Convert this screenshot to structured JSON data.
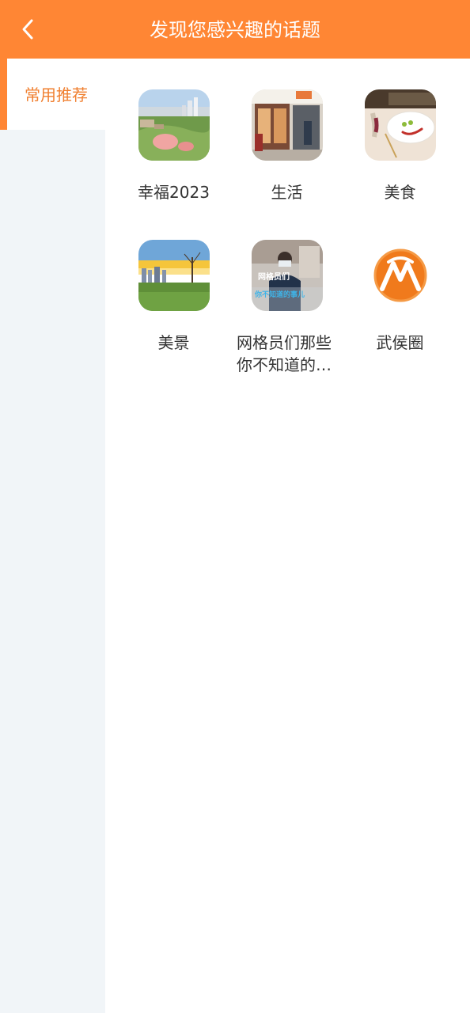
{
  "header": {
    "title": "发现您感兴趣的话题",
    "back_icon": "chevron-left-icon",
    "background": "#ff8634"
  },
  "sidebar": {
    "items": [
      {
        "label": "常用推荐",
        "active": true
      }
    ]
  },
  "topics": [
    {
      "label": "幸福2023",
      "image": "park-aerial-thumbnail"
    },
    {
      "label": "生活",
      "image": "street-storefront-thumbnail"
    },
    {
      "label": "美食",
      "image": "plate-smiley-thumbnail"
    },
    {
      "label": "美景",
      "image": "sunset-skyline-thumbnail"
    },
    {
      "label": "网格员们那些你不知道的事儿",
      "image": "grid-worker-thumbnail",
      "overlay_text": "网格员们 你不知道的事儿"
    },
    {
      "label": "武侯圈",
      "image": "wuhou-logo-thumbnail"
    }
  ],
  "colors": {
    "accent": "#ff8634",
    "sidebar_bg": "#f1f5f8",
    "active_text": "#f07f2f",
    "text": "#333333"
  }
}
